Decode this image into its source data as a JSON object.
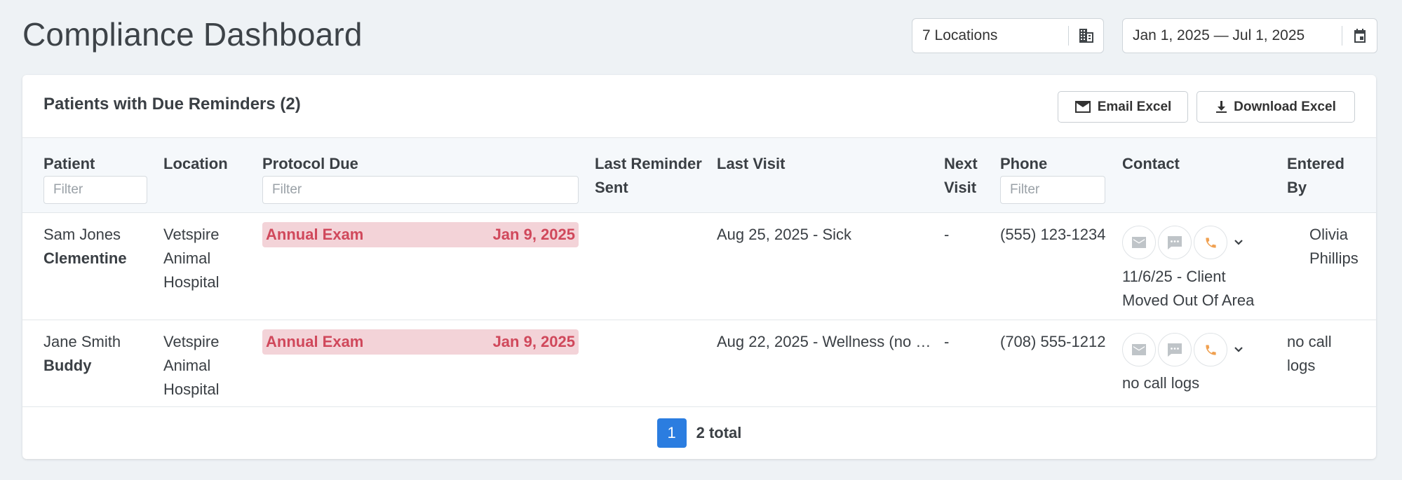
{
  "page": {
    "title": "Compliance Dashboard"
  },
  "filters": {
    "locations": "7 Locations",
    "date_range": "Jan 1, 2025 — Jul 1, 2025"
  },
  "card": {
    "title": "Patients with Due Reminders (2)",
    "email_button": "Email Excel",
    "download_button": "Download Excel"
  },
  "table": {
    "columns": {
      "patient": "Patient",
      "location": "Location",
      "protocol_due": "Protocol Due",
      "last_reminder_line1": "Last Reminder",
      "last_reminder_line2": "Sent",
      "last_visit": "Last Visit",
      "next_visit_line1": "Next",
      "next_visit_line2": "Visit",
      "phone": "Phone",
      "contact": "Contact",
      "entered_by_line1": "Entered",
      "entered_by_line2": "By"
    },
    "filter_placeholder": "Filter",
    "rows": [
      {
        "owner": "Sam Jones",
        "pet": "Clementine",
        "location_lines": [
          "Vetspire",
          "Animal",
          "Hospital"
        ],
        "protocol": "Annual Exam",
        "protocol_date": "Jan 9, 2025",
        "last_reminder": "",
        "last_visit": "Aug 25, 2025 - Sick",
        "next_visit": "-",
        "phone": "(555) 123-1234",
        "contact_note_lines": [
          "11/6/25 - Client",
          "Moved Out Of Area"
        ],
        "entered_by_lines": [
          "Olivia",
          "Phillips"
        ]
      },
      {
        "owner": "Jane Smith",
        "pet": "Buddy",
        "location_lines": [
          "Vetspire",
          "Animal",
          "Hospital"
        ],
        "protocol": "Annual Exam",
        "protocol_date": "Jan 9, 2025",
        "last_reminder": "",
        "last_visit": "Aug 22, 2025 - Wellness (no …",
        "next_visit": "-",
        "phone": "(708) 555-1212",
        "contact_note_lines": [
          "no call logs"
        ],
        "entered_by_lines": [
          "no call",
          "logs"
        ]
      }
    ]
  },
  "pagination": {
    "current_page": "1",
    "total_label": "2 total"
  },
  "colors": {
    "accent": "#2b7de0",
    "protocol_bg": "#f3d3d8",
    "protocol_text": "#d0485b",
    "phone_icon": "#f0a050"
  },
  "icons": [
    "building-icon",
    "calendar-icon",
    "envelope-icon",
    "download-icon",
    "mail-icon",
    "sms-icon",
    "phone-icon",
    "chevron-down-icon"
  ]
}
